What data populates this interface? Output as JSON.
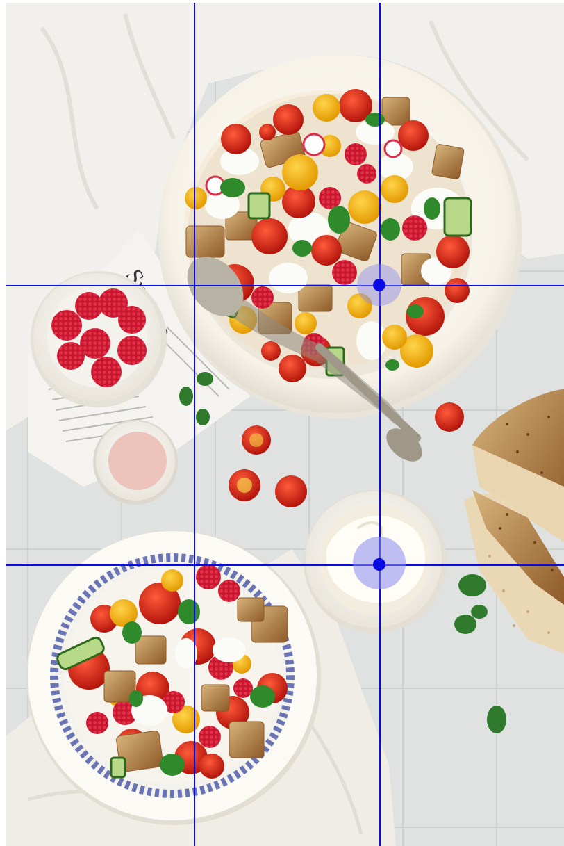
{
  "image": {
    "subject": "rule-of-thirds-food-photo",
    "newspaper_masthead": "Superm"
  },
  "overlay": {
    "guide_color": "#0a0ae6",
    "focus_point_color": "#0a0ae6",
    "focus_halo_color": "#8a8af0",
    "vertical_guides": 2,
    "horizontal_guides": 2,
    "focus_points": 2
  },
  "colors": {
    "tablecloth": "#f1efeb",
    "concrete": "#dfe2e1",
    "plate": "#faf8f2",
    "tomato_red": "#d8231a",
    "cherry_yellow": "#f3b412",
    "bread_crust": "#b07a3e",
    "basil_green": "#2f8a2c",
    "raspberry": "#c9162e",
    "blue_pattern": "#3b4aa3"
  }
}
